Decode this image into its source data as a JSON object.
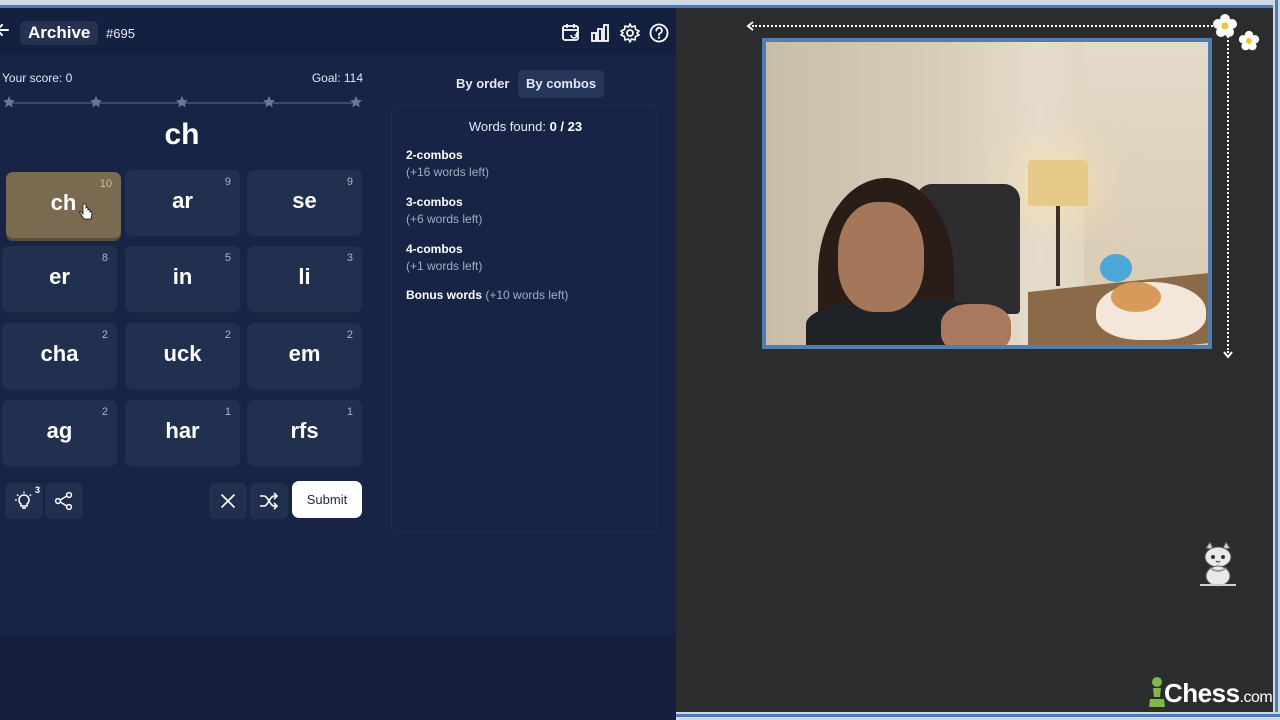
{
  "header": {
    "archive_label": "Archive",
    "puzzle_number": "#695",
    "icons": [
      "calendar-icon",
      "stats-icon",
      "gear-icon",
      "help-icon"
    ]
  },
  "score": {
    "score_label": "Your score: 0",
    "goal_label": "Goal: 114",
    "progress": 0,
    "milestone_stars": 5
  },
  "current_word": "ch",
  "tiles": [
    {
      "text": "ch",
      "count": "10",
      "selected": true
    },
    {
      "text": "ar",
      "count": "9"
    },
    {
      "text": "se",
      "count": "9"
    },
    {
      "text": "er",
      "count": "8"
    },
    {
      "text": "in",
      "count": "5"
    },
    {
      "text": "li",
      "count": "3"
    },
    {
      "text": "cha",
      "count": "2"
    },
    {
      "text": "uck",
      "count": "2"
    },
    {
      "text": "em",
      "count": "2"
    },
    {
      "text": "ag",
      "count": "2"
    },
    {
      "text": "har",
      "count": "1"
    },
    {
      "text": "rfs",
      "count": "1"
    }
  ],
  "actions": {
    "hint_count": "3",
    "submit_label": "Submit"
  },
  "tabs": {
    "by_order": "By order",
    "by_combos": "By combos",
    "active": "by_combos"
  },
  "words": {
    "found_label": "Words found:",
    "found_value": "0 / 23",
    "combos": [
      {
        "name": "2-combos",
        "left": "(+16 words left)"
      },
      {
        "name": "3-combos",
        "left": "(+6 words left)"
      },
      {
        "name": "4-combos",
        "left": "(+1 words left)"
      }
    ],
    "bonus_name": "Bonus words",
    "bonus_left": "(+10 words left)"
  },
  "brand": {
    "name": "Chess",
    "suffix": ".com"
  },
  "colors": {
    "panel_bg": "#172446",
    "tile_bg": "#22304f",
    "tile_selected": "#7a6a4f",
    "stream_bg": "#2a2c2e",
    "cam_border": "#4f7eb3"
  }
}
